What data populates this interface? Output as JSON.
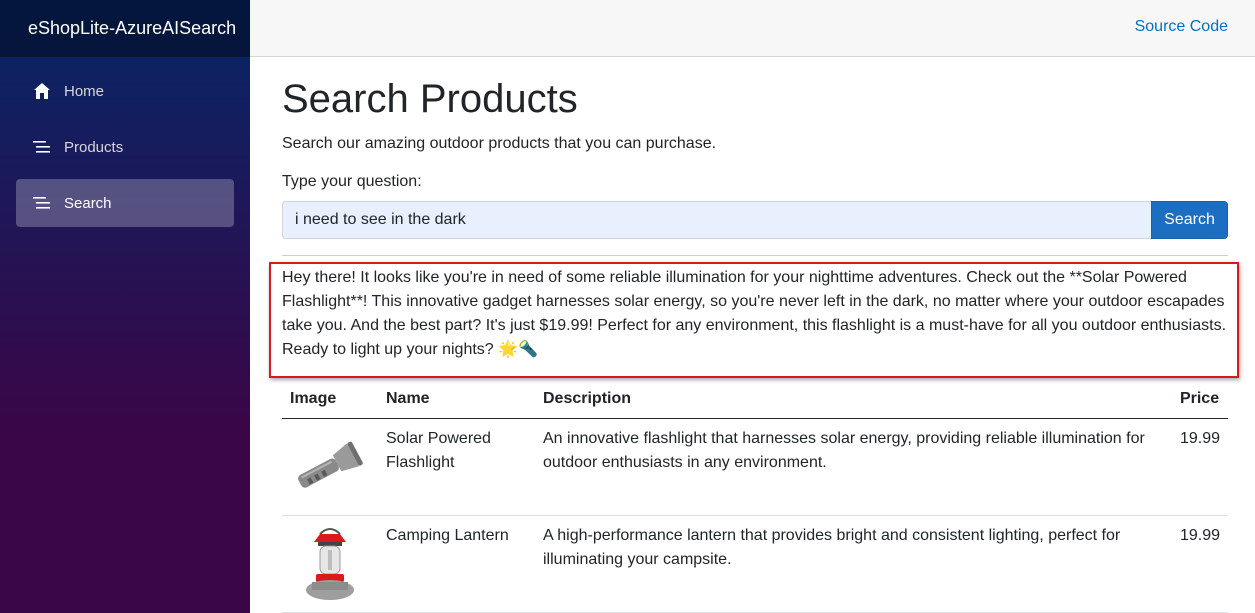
{
  "sidebar": {
    "brand": "eShopLite-AzureAISearch",
    "items": [
      {
        "label": "Home",
        "icon": "home-icon",
        "active": false
      },
      {
        "label": "Products",
        "icon": "list-icon",
        "active": false
      },
      {
        "label": "Search",
        "icon": "list-icon",
        "active": true
      }
    ]
  },
  "header": {
    "source_link": "Source Code"
  },
  "main": {
    "title": "Search Products",
    "intro": "Search our amazing outdoor products that you can purchase.",
    "question_label": "Type your question:",
    "search_value": "i need to see in the dark",
    "search_button": "Search",
    "answer": "Hey there! It looks like you're in need of some reliable illumination for your nighttime adventures. Check out the **Solar Powered Flashlight**! This innovative gadget harnesses solar energy, so you're never left in the dark, no matter where your outdoor escapades take you. And the best part? It's just $19.99! Perfect for any environment, this flashlight is a must-have for all you outdoor enthusiasts. Ready to light up your nights? 🌟🔦"
  },
  "table": {
    "headers": [
      "Image",
      "Name",
      "Description",
      "Price"
    ],
    "rows": [
      {
        "image": "flashlight-image",
        "name": "Solar Powered Flashlight",
        "description": "An innovative flashlight that harnesses solar energy, providing reliable illumination for outdoor enthusiasts in any environment.",
        "price": "19.99"
      },
      {
        "image": "lantern-image",
        "name": "Camping Lantern",
        "description": "A high-performance lantern that provides bright and consistent lighting, perfect for illuminating your campsite.",
        "price": "19.99"
      }
    ]
  },
  "colors": {
    "accent": "#1b6ec2",
    "link": "#0071c1",
    "highlight": "#d9191c",
    "sidebar_top": "#052767",
    "sidebar_bottom": "#3a0647"
  }
}
